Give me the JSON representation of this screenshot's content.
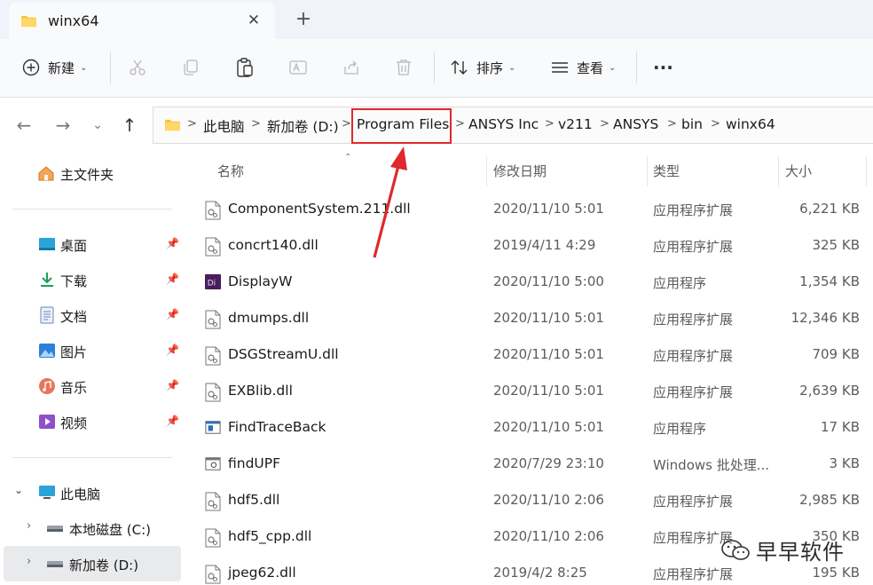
{
  "window": {
    "tab_title": "winx64",
    "tab_close_glyph": "✕",
    "new_tab_glyph": "+"
  },
  "commandbar": {
    "new_label": "新建",
    "sort_label": "排序",
    "view_label": "查看",
    "more_glyph": "···"
  },
  "address": {
    "breadcrumbs": [
      "此电脑",
      "新加卷 (D:)",
      "Program Files",
      "ANSYS Inc",
      "v211",
      "ANSYS",
      "bin",
      "winx64"
    ],
    "highlighted": "Program Files"
  },
  "sidebar": {
    "home": "主文件夹",
    "quick_access": [
      {
        "label": "桌面",
        "icon": "desktop-icon"
      },
      {
        "label": "下载",
        "icon": "download-icon"
      },
      {
        "label": "文档",
        "icon": "document-icon"
      },
      {
        "label": "图片",
        "icon": "pictures-icon"
      },
      {
        "label": "音乐",
        "icon": "music-icon"
      },
      {
        "label": "视频",
        "icon": "video-icon"
      }
    ],
    "this_pc": "此电脑",
    "drives": [
      {
        "label": "本地磁盘 (C:)",
        "selected": false
      },
      {
        "label": "新加卷 (D:)",
        "selected": true
      }
    ]
  },
  "columns": {
    "name": "名称",
    "modified": "修改日期",
    "type": "类型",
    "size": "大小"
  },
  "files": [
    {
      "name": "ComponentSystem.211.dll",
      "date": "2020/11/10 5:01",
      "type": "应用程序扩展",
      "size": "6,221 KB",
      "icon": "dll-icon"
    },
    {
      "name": "concrt140.dll",
      "date": "2019/4/11 4:29",
      "type": "应用程序扩展",
      "size": "325 KB",
      "icon": "dll-icon"
    },
    {
      "name": "DisplayW",
      "date": "2020/11/10 5:00",
      "type": "应用程序",
      "size": "1,354 KB",
      "icon": "display-app-icon"
    },
    {
      "name": "dmumps.dll",
      "date": "2020/11/10 5:01",
      "type": "应用程序扩展",
      "size": "12,346 KB",
      "icon": "dll-icon"
    },
    {
      "name": "DSGStreamU.dll",
      "date": "2020/11/10 5:01",
      "type": "应用程序扩展",
      "size": "709 KB",
      "icon": "dll-icon"
    },
    {
      "name": "EXBlib.dll",
      "date": "2020/11/10 5:01",
      "type": "应用程序扩展",
      "size": "2,639 KB",
      "icon": "dll-icon"
    },
    {
      "name": "FindTraceBack",
      "date": "2020/11/10 5:01",
      "type": "应用程序",
      "size": "17 KB",
      "icon": "exe-icon"
    },
    {
      "name": "findUPF",
      "date": "2020/7/29 23:10",
      "type": "Windows 批处理...",
      "size": "3 KB",
      "icon": "batch-icon"
    },
    {
      "name": "hdf5.dll",
      "date": "2020/11/10 2:06",
      "type": "应用程序扩展",
      "size": "2,985 KB",
      "icon": "dll-icon"
    },
    {
      "name": "hdf5_cpp.dll",
      "date": "2020/11/10 2:06",
      "type": "应用程序扩展",
      "size": "350 KB",
      "icon": "dll-icon"
    },
    {
      "name": "jpeg62.dll",
      "date": "2019/4/2 8:25",
      "type": "应用程序扩展",
      "size": "195 KB",
      "icon": "dll-icon"
    }
  ],
  "watermark": {
    "text": "早早软件"
  },
  "colors": {
    "accent": "#0067c0",
    "highlight_red": "#e0282e",
    "folder_yellow": "#f5c242"
  }
}
